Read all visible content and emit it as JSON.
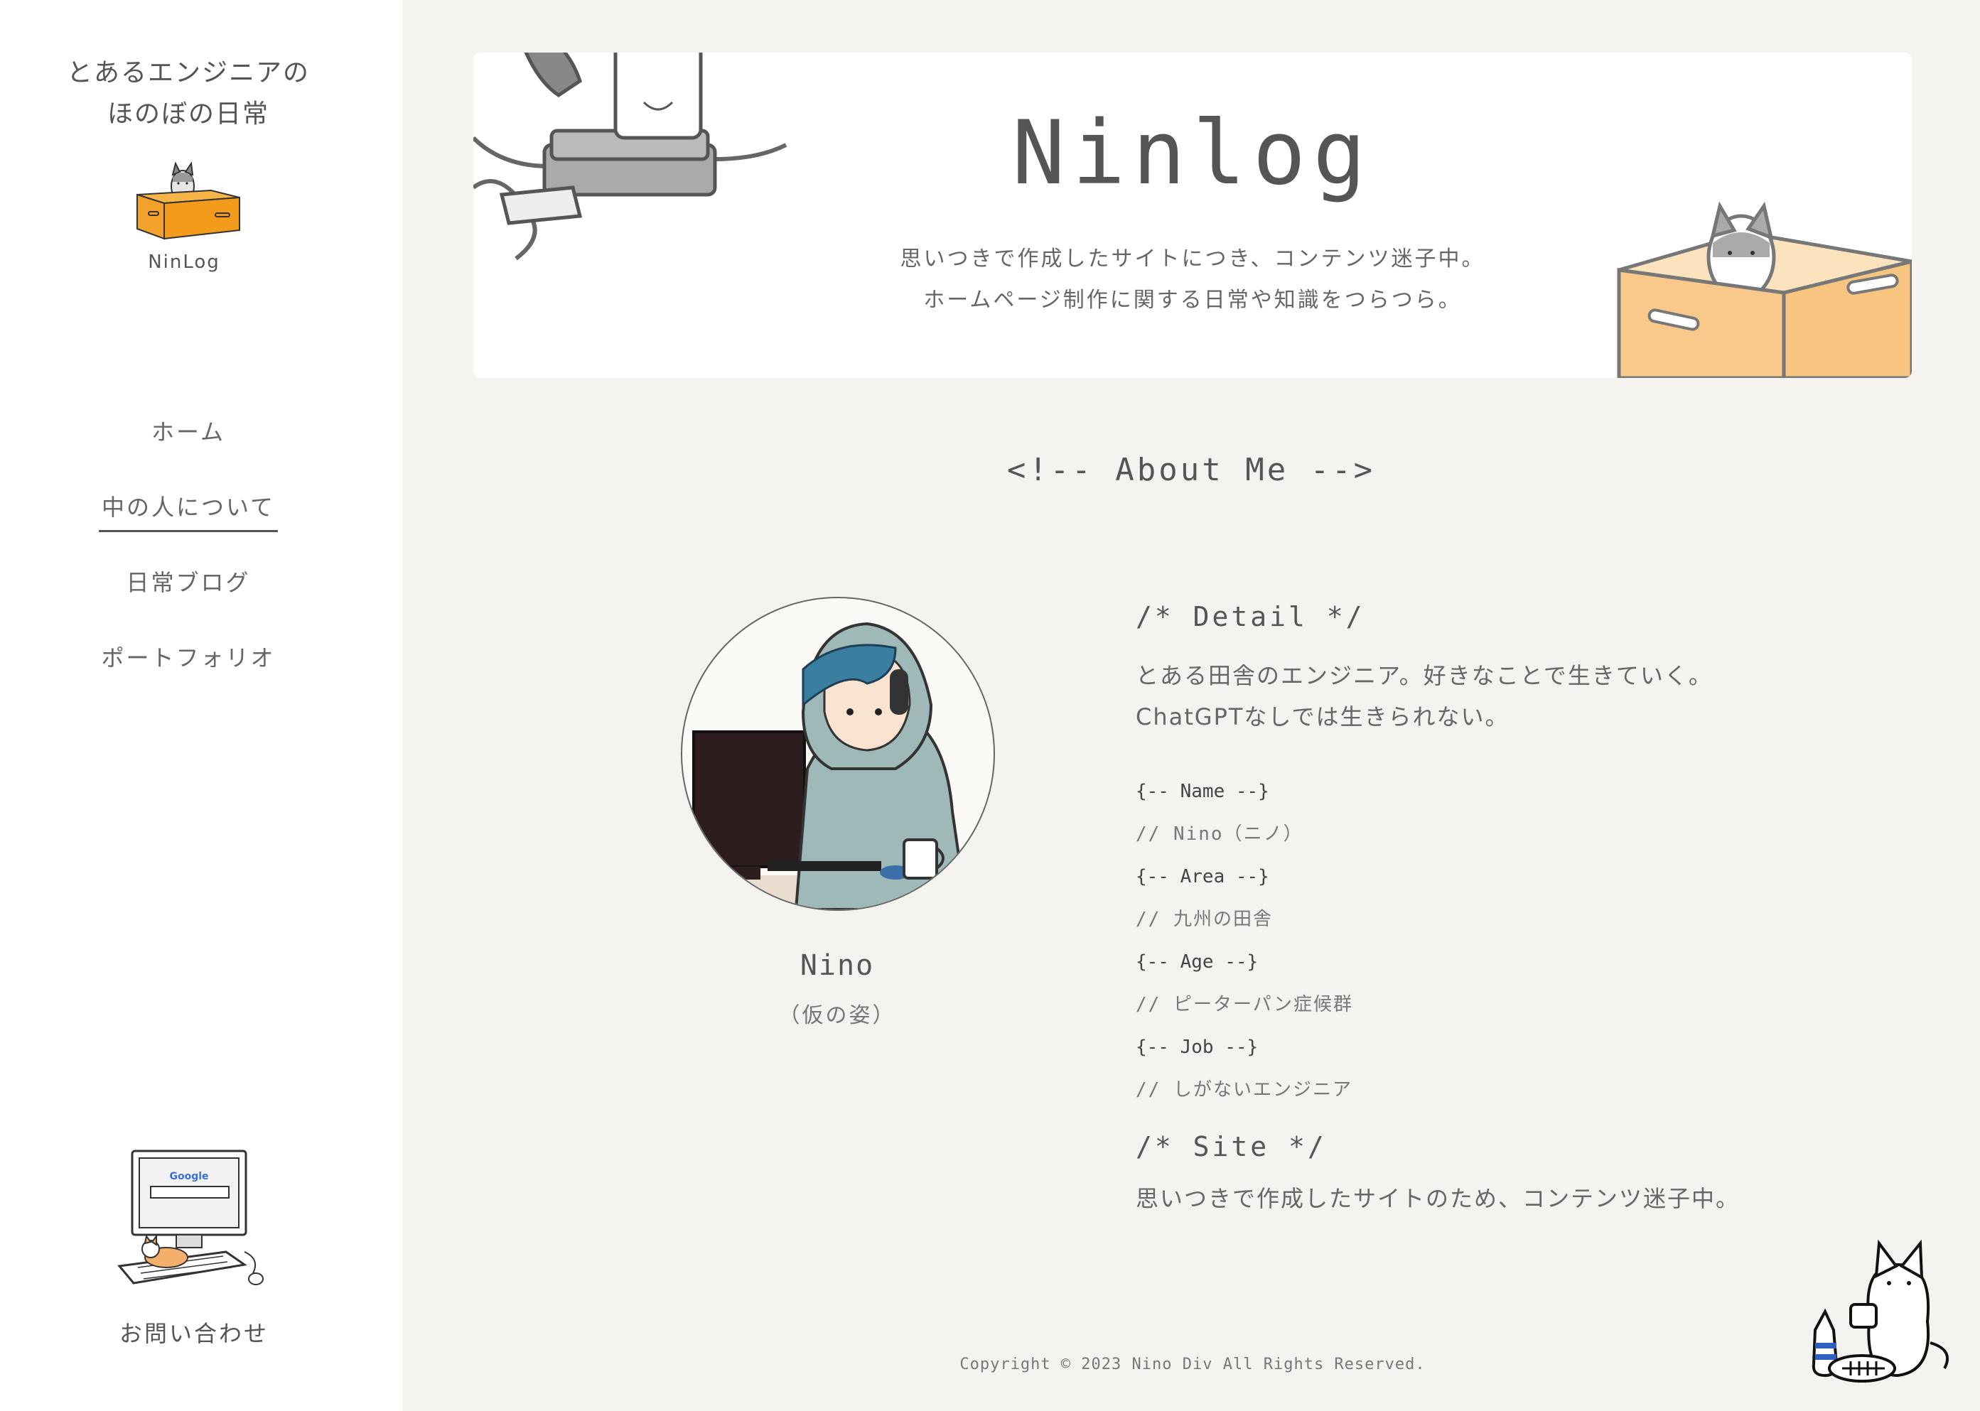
{
  "sidebar": {
    "tagline_line1": "とあるエンジニアの",
    "tagline_line2": "ほのぼの日常",
    "logo_name": "NinLog",
    "nav": [
      {
        "label": "ホーム"
      },
      {
        "label": "中の人について"
      },
      {
        "label": "日常ブログ"
      },
      {
        "label": "ポートフォリオ"
      }
    ],
    "contact_label": "お問い合わせ",
    "contact_art_text": "Google"
  },
  "header": {
    "brand": "Ninlog",
    "desc_line1": "思いつきで作成したサイトにつき、コンテンツ迷子中。",
    "desc_line2": "ホームページ制作に関する日常や知識をつらつら。"
  },
  "about": {
    "section_title": "<!-- About Me -->",
    "name": "Nino",
    "name_sub": "（仮の姿）",
    "detail_heading": "/* Detail */",
    "detail_line1": "とある田舎のエンジニア。好きなことで生きていく。",
    "detail_line2": "ChatGPTなしでは生きられない。",
    "items": [
      {
        "key": "{-- Name --}",
        "value": "// Nino（ニノ）"
      },
      {
        "key": "{-- Area --}",
        "value": "// 九州の田舎"
      },
      {
        "key": "{-- Age --}",
        "value": "// ピーターパン症候群"
      },
      {
        "key": "{-- Job --}",
        "value": "// しがないエンジニア"
      }
    ],
    "site_heading": "/* Site */",
    "site_text": "思いつきで作成したサイトのため、コンテンツ迷子中。"
  },
  "footer": {
    "copyright": "Copyright © 2023 Nino Div All Rights Reserved."
  },
  "colors": {
    "background": "#f4f3ef",
    "sidebar": "#ffffff",
    "text": "#555555",
    "box_orange": "#f2a22a",
    "box_light": "#f7c97e"
  }
}
